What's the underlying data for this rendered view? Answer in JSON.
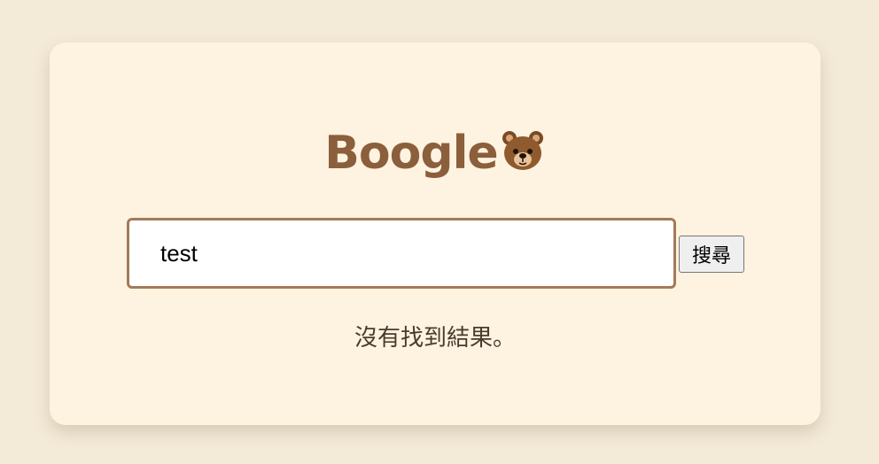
{
  "logo": {
    "text": "Boogle",
    "icon": "bear-face-icon",
    "color": "#8b5e3c"
  },
  "search": {
    "value": "test",
    "button_label": "搜尋"
  },
  "results": {
    "message": "沒有找到結果。"
  },
  "colors": {
    "page_background": "#f4ead8",
    "card_background": "#fdf3e0",
    "input_border": "#a47a58"
  }
}
